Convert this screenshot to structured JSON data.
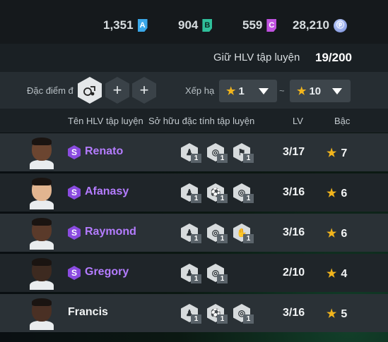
{
  "currencies": [
    {
      "value": "1,351",
      "badge": "A",
      "color": "#3aa7e8"
    },
    {
      "value": "904",
      "badge": "B",
      "color": "#2fbf9a"
    },
    {
      "value": "559",
      "badge": "C",
      "color": "#c052e0"
    },
    {
      "value": "28,210",
      "badge": "",
      "icon": "coin-icon",
      "color": "#7f95e0"
    }
  ],
  "coach_capacity": {
    "label": "Giữ HLV tập luyện",
    "count": "19/200"
  },
  "filters": {
    "trait_label": "Đặc điểm đ",
    "rank_label": "Xếp hạ",
    "rank_from": "1",
    "rank_to": "10",
    "separator": "~"
  },
  "columns": {
    "name": "Tên HLV tập luyện",
    "traits": "Sở hữu đặc tính tập luyện",
    "lv": "LV",
    "rank": "Bậc"
  },
  "coaches": [
    {
      "name": "Renato",
      "special": true,
      "special_badge": "S",
      "lv": "3/17",
      "rank": "7",
      "traits": [
        {
          "icon": "whistle-trait-icon",
          "level": "1"
        },
        {
          "icon": "dribble-trait-icon",
          "level": "1"
        },
        {
          "icon": "tackle-trait-icon",
          "level": "1"
        }
      ]
    },
    {
      "name": "Afanasy",
      "special": true,
      "special_badge": "S",
      "lv": "3/16",
      "rank": "6",
      "traits": [
        {
          "icon": "whistle-trait-icon",
          "level": "1"
        },
        {
          "icon": "header-trait-icon",
          "level": "1"
        },
        {
          "icon": "dribble-trait-icon",
          "level": "1"
        }
      ]
    },
    {
      "name": "Raymond",
      "special": true,
      "special_badge": "S",
      "lv": "3/16",
      "rank": "6",
      "traits": [
        {
          "icon": "whistle-trait-icon",
          "level": "1"
        },
        {
          "icon": "dribble-trait-icon",
          "level": "1"
        },
        {
          "icon": "goalkeeper-trait-icon",
          "level": "1"
        }
      ]
    },
    {
      "name": "Gregory",
      "special": true,
      "special_badge": "S",
      "lv": "2/10",
      "rank": "4",
      "traits": [
        {
          "icon": "whistle-trait-icon",
          "level": "1"
        },
        {
          "icon": "dribble-trait-icon",
          "level": "1"
        }
      ]
    },
    {
      "name": "Francis",
      "special": false,
      "special_badge": "",
      "lv": "3/16",
      "rank": "5",
      "traits": [
        {
          "icon": "whistle-trait-icon",
          "level": "1"
        },
        {
          "icon": "header-trait-icon",
          "level": "1"
        },
        {
          "icon": "dribble-trait-icon",
          "level": "1"
        }
      ]
    }
  ]
}
